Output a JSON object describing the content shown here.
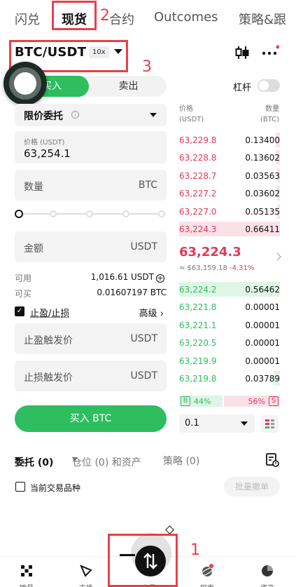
{
  "top_tabs": [
    {
      "label": "闪兑"
    },
    {
      "label": "现货"
    },
    {
      "label": "合约"
    },
    {
      "label": "Outcomes"
    },
    {
      "label": "策略&跟"
    }
  ],
  "annotations": {
    "n1": "1",
    "n2": "2",
    "n3": "3"
  },
  "pair": {
    "name": "BTC/USDT",
    "leverage": "10x"
  },
  "toggle": {
    "buy": "买入",
    "sell": "卖出"
  },
  "leverage_label": "杠杆",
  "form": {
    "order_type": "限价委托",
    "info_icon": "i",
    "price_label": "价格 (USDT)",
    "price_value": "63,254.1",
    "qty_label": "数量",
    "qty_unit": "BTC",
    "amount_label": "金额",
    "amount_unit": "USDT",
    "available_label": "可用",
    "available_value": "1,016.61 USDT",
    "buyable_label": "可买",
    "buyable_value": "0.01607197 BTC",
    "tpsl_label": "止盈/止损",
    "advanced_label": "高级 ›",
    "checkmark": "✓",
    "tp_label": "止盈触发价",
    "tp_unit": "USDT",
    "sl_label": "止损触发价",
    "sl_unit": "USDT",
    "buy_button": "买入 BTC"
  },
  "orderbook": {
    "price_header": [
      "价格",
      "(USDT)"
    ],
    "qty_header": [
      "数量",
      "(BTC)"
    ],
    "asks": [
      {
        "price": "63,229.8",
        "qty": "0.13400",
        "depth": 0.04
      },
      {
        "price": "63,228.8",
        "qty": "0.13602",
        "depth": 0.04
      },
      {
        "price": "63,228.7",
        "qty": "0.03563",
        "depth": 0.02
      },
      {
        "price": "63,227.2",
        "qty": "0.03602",
        "depth": 0.02
      },
      {
        "price": "63,227.0",
        "qty": "0.05135",
        "depth": 0.02
      },
      {
        "price": "63,224.3",
        "qty": "0.66411",
        "depth": 1.0
      }
    ],
    "last_price": "63,224.3",
    "last_usd": "≈ $63,159.18",
    "last_change": "-4.31%",
    "bids": [
      {
        "price": "63,224.2",
        "qty": "0.56462",
        "depth": 1.0
      },
      {
        "price": "63,221.8",
        "qty": "0.00001",
        "depth": 0.0
      },
      {
        "price": "63,221.1",
        "qty": "0.00001",
        "depth": 0.0
      },
      {
        "price": "63,220.5",
        "qty": "0.00001",
        "depth": 0.0
      },
      {
        "price": "63,219.9",
        "qty": "0.00001",
        "depth": 0.0
      },
      {
        "price": "63,219.8",
        "qty": "0.03789",
        "depth": 0.06
      }
    ],
    "buy_tag": "B",
    "buy_ratio": "44%",
    "sell_ratio": "56%",
    "sell_tag": "S",
    "buy_fraction": 0.44,
    "depth_step": "0.1"
  },
  "orders_tabs": {
    "orders": "委托 (0)",
    "positions": "仓位 (0) 和资产",
    "strategies": "策略 (0)"
  },
  "current_pair_only": "当前交易品种",
  "batch_cancel": "批量撤单",
  "bottom_nav": [
    {
      "label": "欧易",
      "icon": "home-icon"
    },
    {
      "label": "市场",
      "icon": "market-icon"
    },
    {
      "label": "交易",
      "icon": "trade-icon"
    },
    {
      "label": "探索",
      "icon": "discover-icon"
    },
    {
      "label": "资产",
      "icon": "assets-icon"
    }
  ],
  "colors": {
    "buy": "#2ebd5f",
    "sell": "#e0395b",
    "annotation": "#e8404a"
  }
}
